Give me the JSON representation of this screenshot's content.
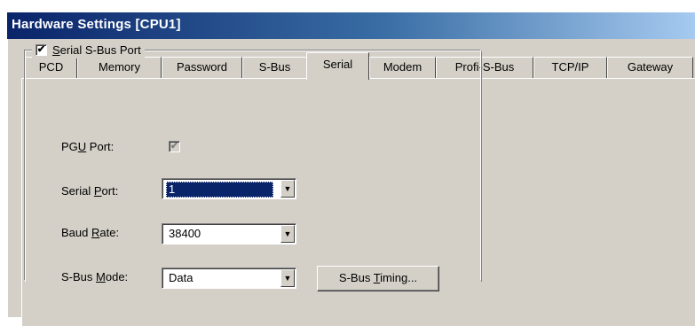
{
  "window": {
    "title": "Hardware Settings [CPU1]"
  },
  "tabs": [
    {
      "label": "PCD",
      "active": false
    },
    {
      "label": "Memory",
      "active": false
    },
    {
      "label": "Password",
      "active": false
    },
    {
      "label": "S-Bus",
      "active": false
    },
    {
      "label": "Serial",
      "active": true
    },
    {
      "label": "Modem",
      "active": false
    },
    {
      "label": "Profi-S-Bus",
      "active": false
    },
    {
      "label": "TCP/IP",
      "active": false
    },
    {
      "label": "Gateway",
      "active": false
    }
  ],
  "group": {
    "label": "Serial S-Bus Port",
    "label_mnemonic": "S",
    "checked": true
  },
  "fields": {
    "pgu_port": {
      "label_pre": "PG",
      "label_mn": "U",
      "label_post": " Port:",
      "checked": true,
      "disabled": true
    },
    "serial_port": {
      "label_pre": "Serial ",
      "label_mn": "P",
      "label_post": "ort:",
      "value": "1"
    },
    "baud_rate": {
      "label_pre": "Baud ",
      "label_mn": "R",
      "label_post": "ate:",
      "value": "38400"
    },
    "sbus_mode": {
      "label_pre": "S-Bus ",
      "label_mn": "M",
      "label_post": "ode:",
      "value": "Data"
    }
  },
  "buttons": {
    "sbus_timing": {
      "label_pre": "S-Bus ",
      "label_mn": "T",
      "label_post": "iming..."
    }
  },
  "icons": {
    "check": "✔",
    "dropdown": "▼"
  }
}
